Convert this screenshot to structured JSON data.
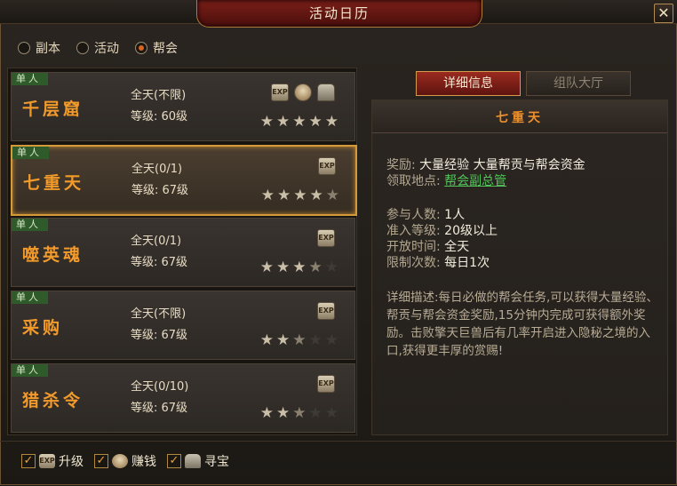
{
  "window": {
    "title": "活动日历",
    "close": "✕"
  },
  "radios": [
    {
      "label": "副本",
      "selected": false
    },
    {
      "label": "活动",
      "selected": false
    },
    {
      "label": "帮会",
      "selected": true
    }
  ],
  "activities": [
    {
      "tag": "单人",
      "name": "千层窟",
      "time": "全天(不限)",
      "level": "等级: 60级",
      "rewards": [
        "exp-icon",
        "money-bag-icon",
        "treasure-icon"
      ],
      "rating": 5
    },
    {
      "tag": "单人",
      "name": "七重天",
      "time": "全天(0/1)",
      "level": "等级: 67级",
      "rewards": [
        "exp-icon"
      ],
      "rating": 4.5
    },
    {
      "tag": "单人",
      "name": "噬英魂",
      "time": "全天(0/1)",
      "level": "等级: 67级",
      "rewards": [
        "exp-icon"
      ],
      "rating": 3.5
    },
    {
      "tag": "单人",
      "name": "采购",
      "time": "全天(不限)",
      "level": "等级: 67级",
      "rewards": [
        "exp-icon"
      ],
      "rating": 2.5
    },
    {
      "tag": "单人",
      "name": "猎杀令",
      "time": "全天(0/10)",
      "level": "等级: 67级",
      "rewards": [
        "exp-icon"
      ],
      "rating": 2.5
    }
  ],
  "tabs": [
    {
      "label": "详细信息",
      "active": true
    },
    {
      "label": "组队大厅",
      "active": false
    }
  ],
  "detail": {
    "title": "七重天",
    "reward_label": "奖励:",
    "reward_value": "大量经验  大量帮贡与帮会资金",
    "location_label": "领取地点:",
    "location_value": "帮会副总管",
    "participants_label": "参与人数:",
    "participants_value": "1人",
    "level_label": "准入等级:",
    "level_value": "20级以上",
    "open_label": "开放时间:",
    "open_value": "全天",
    "limit_label": "限制次数:",
    "limit_value": "每日1次",
    "description": "详细描述:每日必做的帮会任务,可以获得大量经验、帮贡与帮会资金奖励,15分钟内完成可获得额外奖励。击败擎天巨兽后有几率开启进入隐秘之境的入口,获得更丰厚的赏赐!"
  },
  "filters": [
    {
      "label": "升级",
      "icon": "exp-icon",
      "checked": true
    },
    {
      "label": "赚钱",
      "icon": "money-bag-icon",
      "checked": true
    },
    {
      "label": "寻宝",
      "icon": "treasure-icon",
      "checked": true
    }
  ],
  "colors": {
    "accent": "#f29a2a",
    "tab_active": "#9a2a1f",
    "link": "#52c25a",
    "selected_border": "#d49a3a"
  }
}
